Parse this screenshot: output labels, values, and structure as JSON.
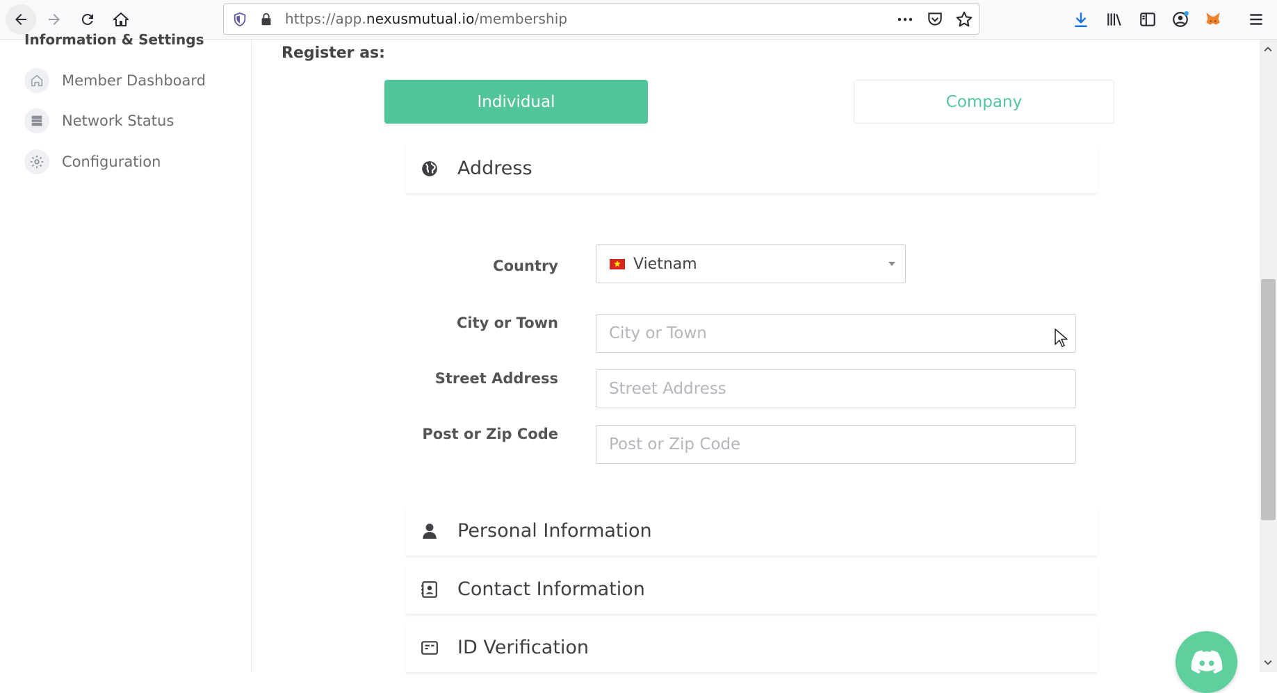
{
  "browser": {
    "url_prefix": "https://app.",
    "url_host": "nexusmutual.io",
    "url_path": "/membership",
    "icons": [
      "back-icon",
      "forward-icon",
      "reload-icon",
      "home-icon",
      "shield-icon",
      "lock-icon",
      "more-icon",
      "pocket-icon",
      "star-icon",
      "download-icon",
      "library-icon",
      "sidebar-icon",
      "account-icon",
      "metamask-icon",
      "menu-icon"
    ]
  },
  "sidebar": {
    "heading": "Information & Settings",
    "items": [
      {
        "label": "Member Dashboard",
        "icon": "home-icon"
      },
      {
        "label": "Network Status",
        "icon": "server-icon"
      },
      {
        "label": "Configuration",
        "icon": "gear-icon"
      }
    ]
  },
  "register": {
    "label": "Register as:",
    "options": [
      {
        "label": "Individual",
        "selected": true
      },
      {
        "label": "Company",
        "selected": false
      }
    ]
  },
  "address": {
    "title": "Address",
    "country_label": "Country",
    "country_value": "Vietnam",
    "city_label": "City or Town",
    "city_placeholder": "City or Town",
    "street_label": "Street Address",
    "street_placeholder": "Street Address",
    "zip_label": "Post or Zip Code",
    "zip_placeholder": "Post or Zip Code"
  },
  "sections": [
    {
      "title": "Personal Information",
      "icon": "user-icon"
    },
    {
      "title": "Contact Information",
      "icon": "contact-card-icon"
    },
    {
      "title": "ID Verification",
      "icon": "id-card-icon"
    }
  ],
  "colors": {
    "accent": "#52c59a",
    "discord_bubble": "#5fcf9e"
  }
}
